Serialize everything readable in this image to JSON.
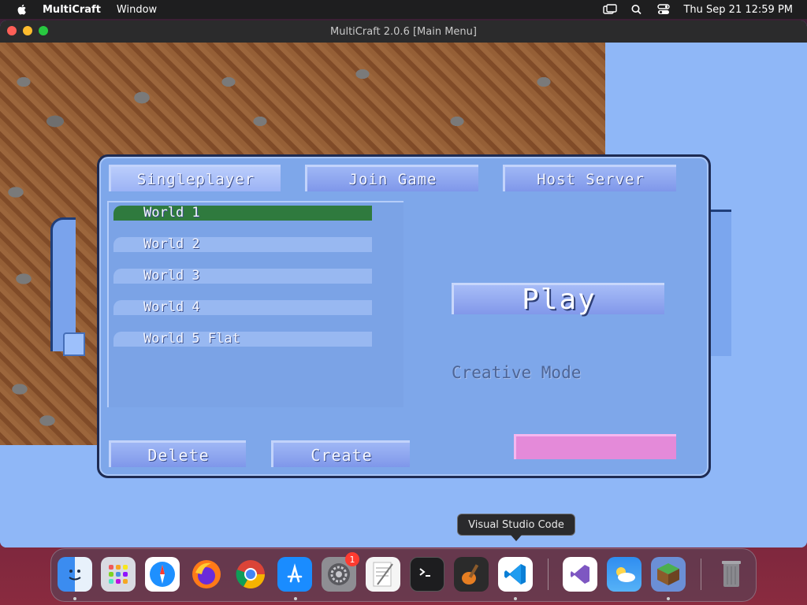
{
  "menubar": {
    "app_name": "MultiCraft",
    "items": [
      "Window"
    ],
    "clock": "Thu Sep 21  12:59 PM"
  },
  "window": {
    "title": "MultiCraft 2.0.6 [Main Menu]"
  },
  "main_menu": {
    "tabs": [
      {
        "label": "Singleplayer",
        "active": true
      },
      {
        "label": "Join Game",
        "active": false
      },
      {
        "label": "Host Server",
        "active": false
      }
    ],
    "worlds": [
      {
        "label": "World 1",
        "selected": true
      },
      {
        "label": "World 2",
        "selected": false
      },
      {
        "label": "World 3",
        "selected": false
      },
      {
        "label": "World 4",
        "selected": false
      },
      {
        "label": "World 5 Flat",
        "selected": false
      }
    ],
    "play_label": "Play",
    "mode_label": "Creative Mode",
    "delete_label": "Delete",
    "create_label": "Create"
  },
  "dock": {
    "tooltip": "Visual Studio Code",
    "apps": [
      {
        "name": "Finder",
        "icon": "finder-icon"
      },
      {
        "name": "Launchpad",
        "icon": "launchpad-icon"
      },
      {
        "name": "Safari",
        "icon": "safari-icon"
      },
      {
        "name": "Firefox",
        "icon": "firefox-icon"
      },
      {
        "name": "Chrome",
        "icon": "chrome-icon"
      },
      {
        "name": "App Store",
        "icon": "app-store-icon"
      },
      {
        "name": "System Settings",
        "icon": "settings-icon",
        "badge": "1"
      },
      {
        "name": "TextEdit",
        "icon": "textedit-icon"
      },
      {
        "name": "Terminal",
        "icon": "terminal-icon"
      },
      {
        "name": "GarageBand",
        "icon": "garageband-icon"
      },
      {
        "name": "Visual Studio Code",
        "icon": "vscode-icon"
      },
      {
        "name": "Visual Studio",
        "icon": "visual-studio-icon"
      },
      {
        "name": "Weather",
        "icon": "weather-icon"
      },
      {
        "name": "MultiCraft",
        "icon": "multicraft-icon"
      },
      {
        "name": "Trash",
        "icon": "trash-icon"
      }
    ]
  },
  "colors": {
    "sky": "#8fb7f7",
    "panel": "#7ea7ea",
    "selected_world": "#2f7a3e",
    "mode_bar": "#e48ad9"
  }
}
